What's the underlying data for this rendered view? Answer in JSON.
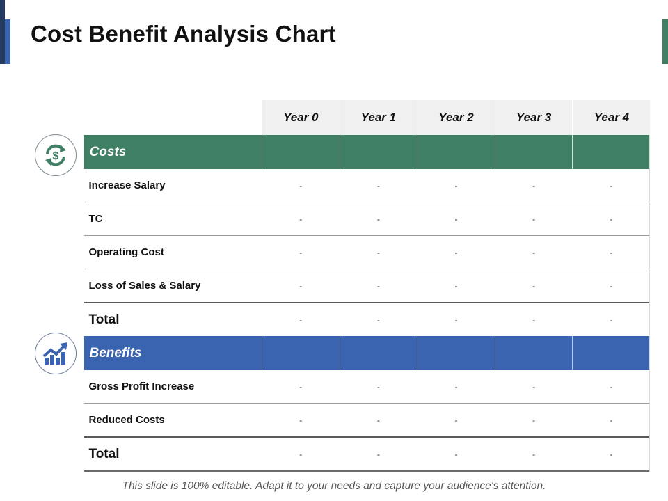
{
  "slide": {
    "title": "Cost Benefit Analysis Chart",
    "footer": "This slide is 100% editable. Adapt it to your needs and capture your audience's attention.",
    "colors": {
      "costs": "#3f7f63",
      "benefits": "#3a63b0",
      "header_bg": "#f0f0f0",
      "accent_dark": "#243a5e"
    }
  },
  "table": {
    "columns": [
      "Year 0",
      "Year 1",
      "Year 2",
      "Year 3",
      "Year 4"
    ],
    "costs": {
      "label": "Costs",
      "icon": "dollar-cycle-icon",
      "rows": [
        {
          "label": "Increase Salary",
          "values": [
            "-",
            "-",
            "-",
            "-",
            "-"
          ]
        },
        {
          "label": "TC",
          "values": [
            "-",
            "-",
            "-",
            "-",
            "-"
          ]
        },
        {
          "label": "Operating Cost",
          "values": [
            "-",
            "-",
            "-",
            "-",
            "-"
          ]
        },
        {
          "label": "Loss of Sales & Salary",
          "values": [
            "-",
            "-",
            "-",
            "-",
            "-"
          ]
        }
      ],
      "total": {
        "label": "Total",
        "values": [
          "-",
          "-",
          "-",
          "-",
          "-"
        ]
      }
    },
    "benefits": {
      "label": "Benefits",
      "icon": "growth-chart-icon",
      "rows": [
        {
          "label": "Gross Profit Increase",
          "values": [
            "-",
            "-",
            "-",
            "-",
            "-"
          ]
        },
        {
          "label": "Reduced Costs",
          "values": [
            "-",
            "-",
            "-",
            "-",
            "-"
          ]
        }
      ],
      "total": {
        "label": "Total",
        "values": [
          "-",
          "-",
          "-",
          "-",
          "-"
        ]
      }
    }
  }
}
